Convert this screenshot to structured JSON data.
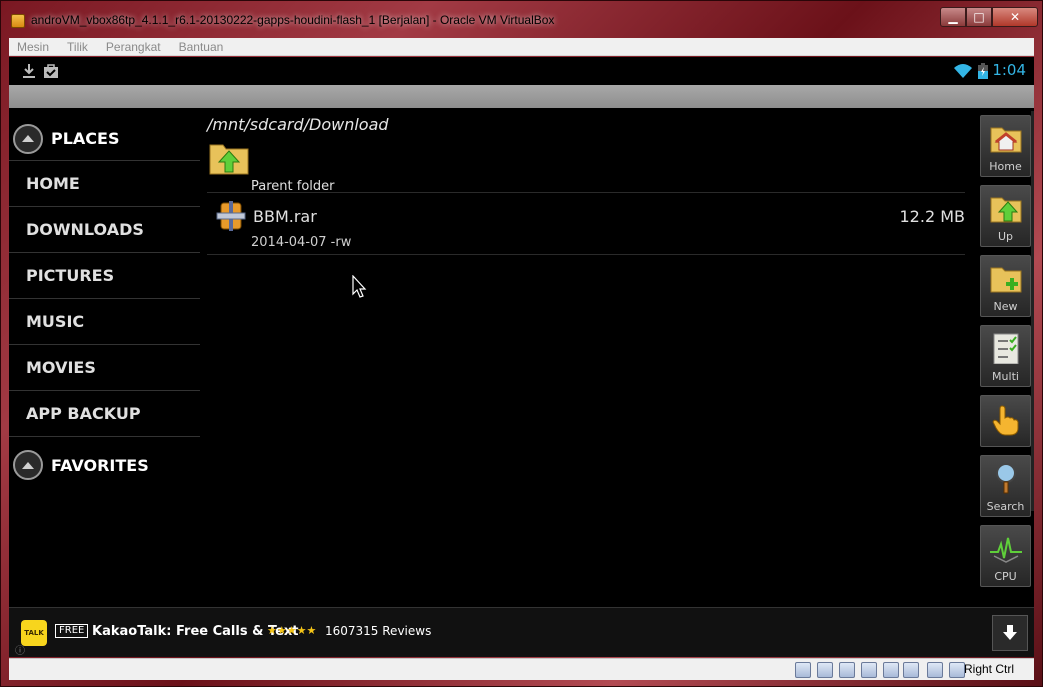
{
  "window": {
    "title": "androVM_vbox86tp_4.1.1_r6.1-20130222-gapps-houdini-flash_1 [Berjalan] - Oracle VM VirtualBox",
    "min_glyph": "▁",
    "max_glyph": "□",
    "close_glyph": "✕"
  },
  "menubar": {
    "items": [
      {
        "label": "Mesin"
      },
      {
        "label": "Tilik"
      },
      {
        "label": "Perangkat"
      },
      {
        "label": "Bantuan"
      }
    ]
  },
  "android_status": {
    "time": "1:04",
    "accent_color": "#33b5e5"
  },
  "sidebar": {
    "places_label": "PLACES",
    "items": [
      {
        "label": "HOME"
      },
      {
        "label": "DOWNLOADS"
      },
      {
        "label": "PICTURES"
      },
      {
        "label": "MUSIC"
      },
      {
        "label": "MOVIES"
      },
      {
        "label": "APP BACKUP"
      }
    ],
    "favorites_label": "FAVORITES"
  },
  "browser": {
    "path": "/mnt/sdcard/Download",
    "parent_label": "Parent folder",
    "files": [
      {
        "name": "BBM.rar",
        "meta": "2014-04-07 -rw",
        "size": "12.2 MB"
      }
    ]
  },
  "toolbar": {
    "buttons": [
      {
        "label": "Home",
        "icon": "folder-home-icon"
      },
      {
        "label": "Up",
        "icon": "folder-up-icon"
      },
      {
        "label": "New",
        "icon": "folder-new-icon"
      },
      {
        "label": "Multi",
        "icon": "multi-select-icon"
      },
      {
        "label": "",
        "icon": "hand-pointer-icon"
      },
      {
        "label": "Search",
        "icon": "magnifier-icon"
      },
      {
        "label": "CPU",
        "icon": "cpu-graph-icon"
      }
    ]
  },
  "ad": {
    "logo_text": "TALK",
    "free_label": "FREE",
    "title": "KakaoTalk: Free Calls & Text",
    "stars": "★★★★★",
    "rating": 4.5,
    "reviews": "1607315 Reviews",
    "info_glyph": "ⓘ"
  },
  "vbox_status": {
    "host_key": "Right Ctrl"
  }
}
